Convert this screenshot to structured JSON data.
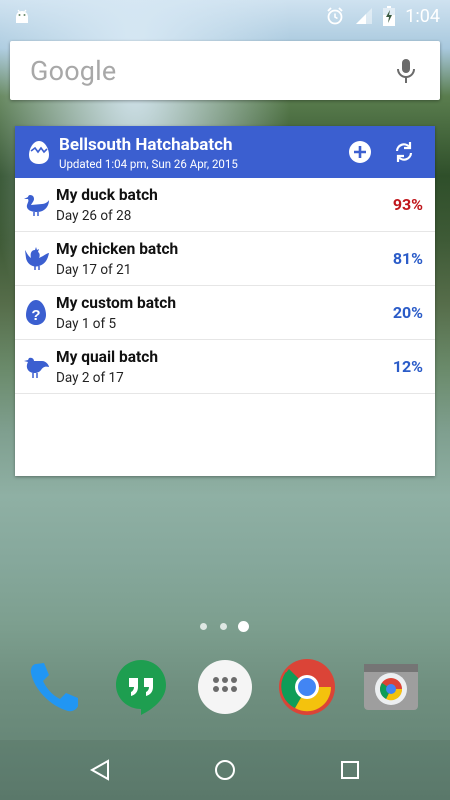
{
  "status_bar": {
    "time": "1:04",
    "icons": [
      "android-icon",
      "alarm-icon",
      "signal-icon",
      "battery-charging-icon"
    ]
  },
  "search": {
    "logo_text": "Google",
    "icon": "mic-icon"
  },
  "widget": {
    "title": "Bellsouth Hatchabatch",
    "updated": "Updated 1:04 pm, Sun 26 Apr, 2015",
    "header_color": "#3b5fd0",
    "batches": [
      {
        "name": "My duck batch",
        "day": "Day 26 of 28",
        "percent": "93%",
        "icon": "duck-icon",
        "percent_color": "#c0171c"
      },
      {
        "name": "My chicken batch",
        "day": "Day 17 of 21",
        "percent": "81%",
        "icon": "chicken-icon",
        "percent_color": "#2b5cc8"
      },
      {
        "name": "My custom batch",
        "day": "Day 1 of 5",
        "percent": "20%",
        "icon": "question-icon",
        "percent_color": "#2b5cc8"
      },
      {
        "name": "My quail batch",
        "day": "Day 2 of 17",
        "percent": "12%",
        "icon": "quail-icon",
        "percent_color": "#2b5cc8"
      }
    ]
  },
  "page_indicator": {
    "count": 3,
    "active": 2
  },
  "dock": {
    "apps": [
      "phone-icon",
      "hangouts-icon",
      "app-drawer-icon",
      "chrome-icon",
      "camera-icon"
    ]
  },
  "nav": {
    "buttons": [
      "back-icon",
      "home-icon",
      "recents-icon"
    ]
  }
}
